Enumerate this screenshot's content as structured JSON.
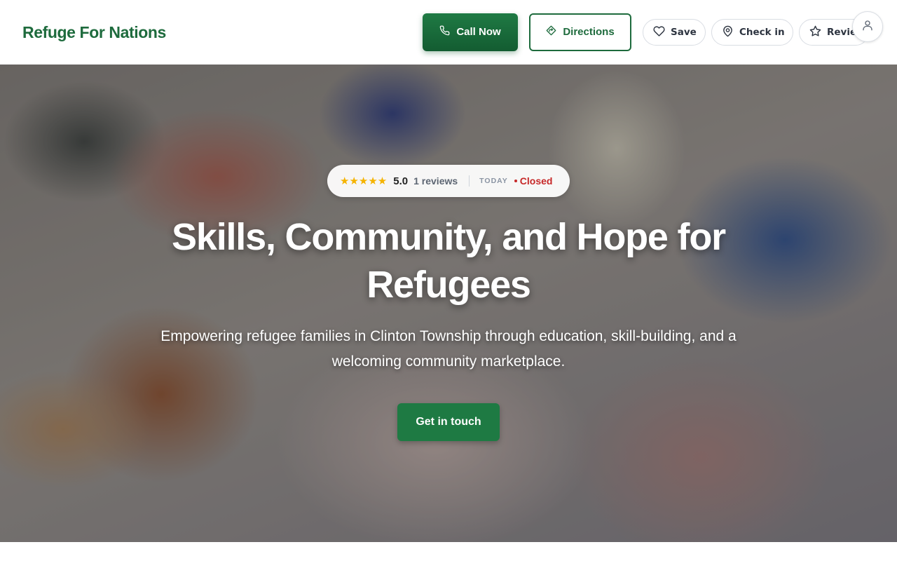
{
  "header": {
    "brand": "Refuge For Nations",
    "call_label": "Call Now",
    "directions_label": "Directions",
    "save_label": "Save",
    "checkin_label": "Check in",
    "review_label": "Review"
  },
  "hero": {
    "stars": "★★★★★",
    "rating": "5.0",
    "reviews": "1 reviews",
    "today_label": "TODAY",
    "status": "Closed",
    "title": "Skills, Community, and Hope for Refugees",
    "subtitle": "Empowering refugee families in Clinton Township through education, skill-building, and a welcoming community marketplace.",
    "cta_label": "Get in touch"
  },
  "colors": {
    "brand_green": "#1e6b3d",
    "status_red": "#c62828",
    "star_yellow": "#f5b300"
  },
  "icons": {
    "call": "phone-icon",
    "directions": "diamond-arrow-icon",
    "save": "heart-icon",
    "checkin": "map-pin-icon",
    "review": "star-icon",
    "account": "user-icon"
  }
}
